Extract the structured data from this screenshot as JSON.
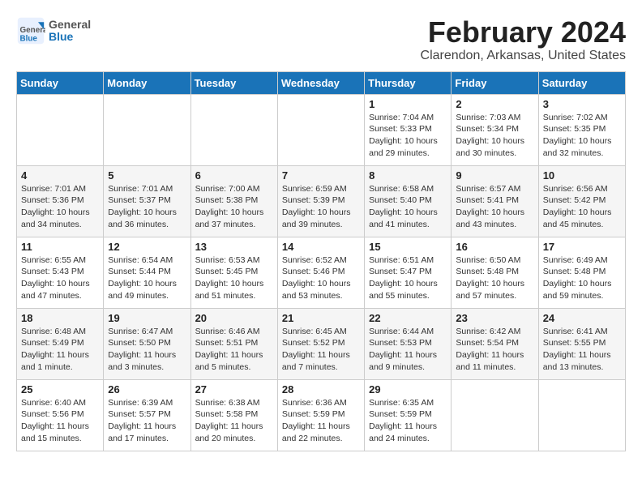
{
  "header": {
    "logo_general": "General",
    "logo_blue": "Blue",
    "month_year": "February 2024",
    "location": "Clarendon, Arkansas, United States"
  },
  "days_of_week": [
    "Sunday",
    "Monday",
    "Tuesday",
    "Wednesday",
    "Thursday",
    "Friday",
    "Saturday"
  ],
  "weeks": [
    [
      {
        "day": "",
        "info": ""
      },
      {
        "day": "",
        "info": ""
      },
      {
        "day": "",
        "info": ""
      },
      {
        "day": "",
        "info": ""
      },
      {
        "day": "1",
        "info": "Sunrise: 7:04 AM\nSunset: 5:33 PM\nDaylight: 10 hours\nand 29 minutes."
      },
      {
        "day": "2",
        "info": "Sunrise: 7:03 AM\nSunset: 5:34 PM\nDaylight: 10 hours\nand 30 minutes."
      },
      {
        "day": "3",
        "info": "Sunrise: 7:02 AM\nSunset: 5:35 PM\nDaylight: 10 hours\nand 32 minutes."
      }
    ],
    [
      {
        "day": "4",
        "info": "Sunrise: 7:01 AM\nSunset: 5:36 PM\nDaylight: 10 hours\nand 34 minutes."
      },
      {
        "day": "5",
        "info": "Sunrise: 7:01 AM\nSunset: 5:37 PM\nDaylight: 10 hours\nand 36 minutes."
      },
      {
        "day": "6",
        "info": "Sunrise: 7:00 AM\nSunset: 5:38 PM\nDaylight: 10 hours\nand 37 minutes."
      },
      {
        "day": "7",
        "info": "Sunrise: 6:59 AM\nSunset: 5:39 PM\nDaylight: 10 hours\nand 39 minutes."
      },
      {
        "day": "8",
        "info": "Sunrise: 6:58 AM\nSunset: 5:40 PM\nDaylight: 10 hours\nand 41 minutes."
      },
      {
        "day": "9",
        "info": "Sunrise: 6:57 AM\nSunset: 5:41 PM\nDaylight: 10 hours\nand 43 minutes."
      },
      {
        "day": "10",
        "info": "Sunrise: 6:56 AM\nSunset: 5:42 PM\nDaylight: 10 hours\nand 45 minutes."
      }
    ],
    [
      {
        "day": "11",
        "info": "Sunrise: 6:55 AM\nSunset: 5:43 PM\nDaylight: 10 hours\nand 47 minutes."
      },
      {
        "day": "12",
        "info": "Sunrise: 6:54 AM\nSunset: 5:44 PM\nDaylight: 10 hours\nand 49 minutes."
      },
      {
        "day": "13",
        "info": "Sunrise: 6:53 AM\nSunset: 5:45 PM\nDaylight: 10 hours\nand 51 minutes."
      },
      {
        "day": "14",
        "info": "Sunrise: 6:52 AM\nSunset: 5:46 PM\nDaylight: 10 hours\nand 53 minutes."
      },
      {
        "day": "15",
        "info": "Sunrise: 6:51 AM\nSunset: 5:47 PM\nDaylight: 10 hours\nand 55 minutes."
      },
      {
        "day": "16",
        "info": "Sunrise: 6:50 AM\nSunset: 5:48 PM\nDaylight: 10 hours\nand 57 minutes."
      },
      {
        "day": "17",
        "info": "Sunrise: 6:49 AM\nSunset: 5:48 PM\nDaylight: 10 hours\nand 59 minutes."
      }
    ],
    [
      {
        "day": "18",
        "info": "Sunrise: 6:48 AM\nSunset: 5:49 PM\nDaylight: 11 hours\nand 1 minute."
      },
      {
        "day": "19",
        "info": "Sunrise: 6:47 AM\nSunset: 5:50 PM\nDaylight: 11 hours\nand 3 minutes."
      },
      {
        "day": "20",
        "info": "Sunrise: 6:46 AM\nSunset: 5:51 PM\nDaylight: 11 hours\nand 5 minutes."
      },
      {
        "day": "21",
        "info": "Sunrise: 6:45 AM\nSunset: 5:52 PM\nDaylight: 11 hours\nand 7 minutes."
      },
      {
        "day": "22",
        "info": "Sunrise: 6:44 AM\nSunset: 5:53 PM\nDaylight: 11 hours\nand 9 minutes."
      },
      {
        "day": "23",
        "info": "Sunrise: 6:42 AM\nSunset: 5:54 PM\nDaylight: 11 hours\nand 11 minutes."
      },
      {
        "day": "24",
        "info": "Sunrise: 6:41 AM\nSunset: 5:55 PM\nDaylight: 11 hours\nand 13 minutes."
      }
    ],
    [
      {
        "day": "25",
        "info": "Sunrise: 6:40 AM\nSunset: 5:56 PM\nDaylight: 11 hours\nand 15 minutes."
      },
      {
        "day": "26",
        "info": "Sunrise: 6:39 AM\nSunset: 5:57 PM\nDaylight: 11 hours\nand 17 minutes."
      },
      {
        "day": "27",
        "info": "Sunrise: 6:38 AM\nSunset: 5:58 PM\nDaylight: 11 hours\nand 20 minutes."
      },
      {
        "day": "28",
        "info": "Sunrise: 6:36 AM\nSunset: 5:59 PM\nDaylight: 11 hours\nand 22 minutes."
      },
      {
        "day": "29",
        "info": "Sunrise: 6:35 AM\nSunset: 5:59 PM\nDaylight: 11 hours\nand 24 minutes."
      },
      {
        "day": "",
        "info": ""
      },
      {
        "day": "",
        "info": ""
      }
    ]
  ]
}
